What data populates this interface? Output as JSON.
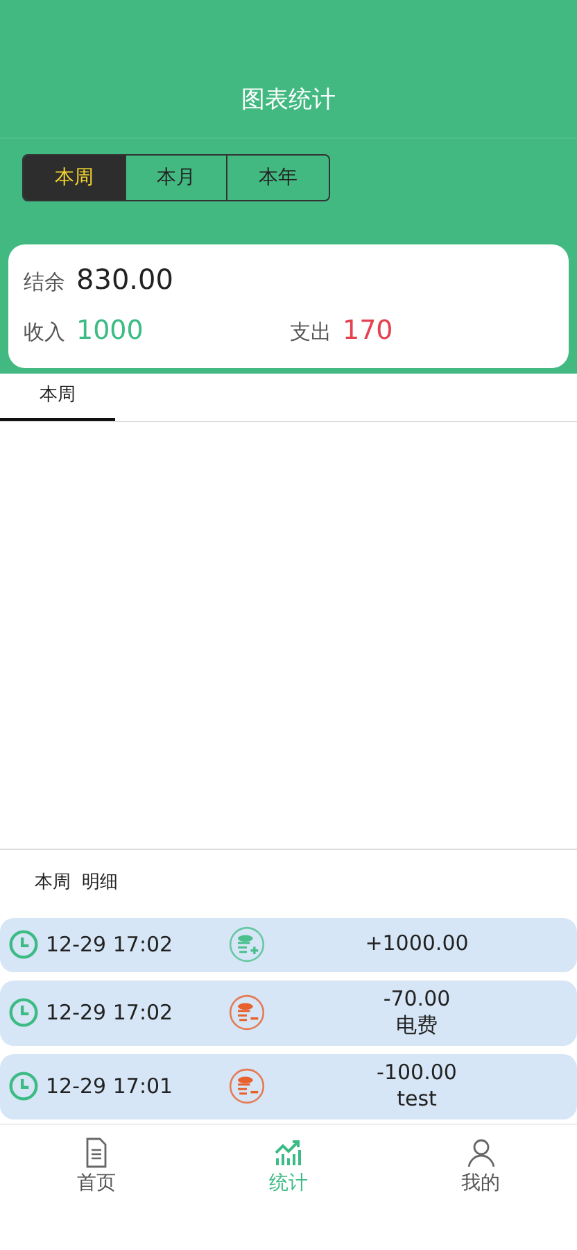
{
  "header": {
    "title": "图表统计"
  },
  "periods": [
    {
      "label": "本周",
      "selected": true
    },
    {
      "label": "本月",
      "selected": false
    },
    {
      "label": "本年",
      "selected": false
    }
  ],
  "summary": {
    "balance_label": "结余",
    "balance": "830.00",
    "income_label": "收入",
    "income": "1000",
    "expense_label": "支出",
    "expense": "170"
  },
  "chart_tabs": [
    {
      "label": "本周",
      "selected": true
    }
  ],
  "detail": {
    "period": "本周",
    "title": "明细"
  },
  "entries": [
    {
      "time": "12-29 17:02",
      "kind": "income",
      "amount": "+1000.00"
    },
    {
      "time": "12-29 17:02",
      "kind": "expense",
      "amount": "-70.00",
      "note": "电费"
    },
    {
      "time": "12-29 17:01",
      "kind": "expense",
      "amount": "-100.00",
      "note": "test"
    }
  ],
  "nav": [
    {
      "label": "首页",
      "kind": "document",
      "selected": false
    },
    {
      "label": "统计",
      "kind": "chart",
      "selected": true
    },
    {
      "label": "我的",
      "kind": "person",
      "selected": false
    }
  ]
}
